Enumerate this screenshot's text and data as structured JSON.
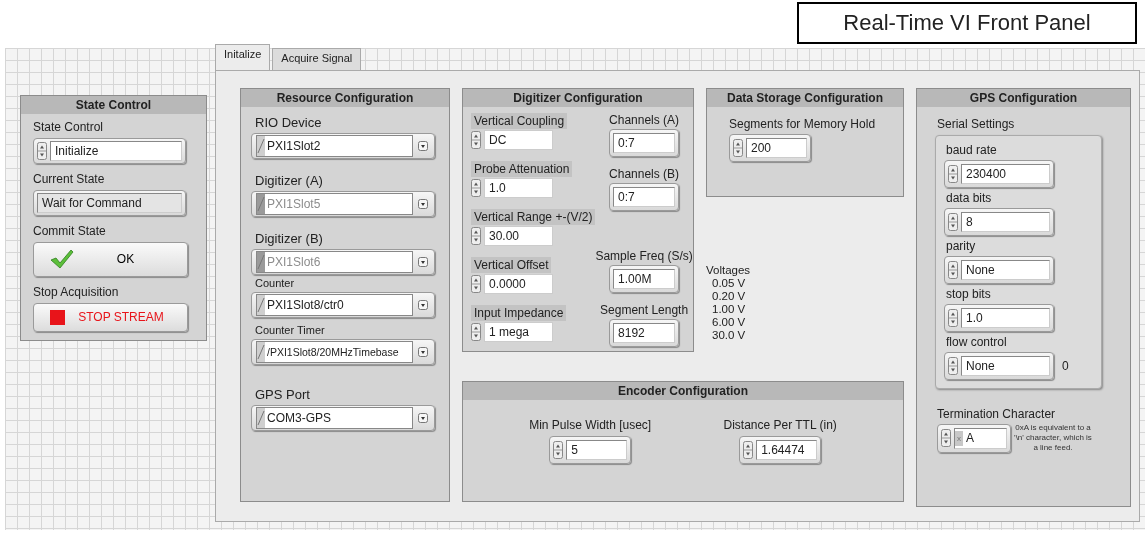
{
  "title": "Real-Time VI Front Panel",
  "state_control": {
    "title": "State Control",
    "controls": [
      {
        "kind": "ring",
        "label": "State Control",
        "value": "Initialize"
      },
      {
        "kind": "indicator",
        "label": "Current State",
        "value": "Wait for Command"
      },
      {
        "kind": "confirm_button",
        "label": "Commit State",
        "value": "OK"
      },
      {
        "kind": "stop_button",
        "label": "Stop Acquisition",
        "value": "STOP STREAM"
      }
    ]
  },
  "tabs": [
    {
      "label": "Initalize",
      "selected": true
    },
    {
      "label": "Acquire Signal",
      "selected": false
    }
  ],
  "resource_configuration": {
    "title": "Resource Configuration",
    "fields": [
      {
        "label": "RIO Device",
        "value": "PXI1Slot2",
        "disabled": false
      },
      {
        "label": "Digitizer (A)",
        "value": "PXI1Slot5",
        "disabled": true
      },
      {
        "label": "Digitizer (B)",
        "value": "PXI1Slot6",
        "disabled": true
      },
      {
        "label": "Counter",
        "value": "PXI1Slot8/ctr0",
        "disabled": false
      },
      {
        "label": "Counter Timer",
        "value": "/PXI1Slot8/20MHzTimebase",
        "disabled": false
      },
      {
        "label": "GPS Port",
        "value": "COM3-GPS",
        "disabled": false
      }
    ]
  },
  "digitizer_configuration": {
    "title": "Digitizer Configuration",
    "controls": [
      {
        "label": "Vertical Coupling",
        "value": "DC"
      },
      {
        "label": "Probe Attenuation",
        "value": "1.0"
      },
      {
        "label": "Vertical Range +-(V/2)",
        "value": "30.00"
      },
      {
        "label": "Vertical Offset",
        "value": "0.0000"
      },
      {
        "label": "Input Impedance",
        "value": "1 mega"
      }
    ],
    "indicators": [
      {
        "label": "Channels (A)",
        "value": "0:7"
      },
      {
        "label": "Channels (B)",
        "value": "0:7"
      },
      {
        "label": "Sample Freq (S/s)",
        "value": "1.00M"
      },
      {
        "label": "Segment Length",
        "value": "8192"
      }
    ]
  },
  "data_storage_configuration": {
    "title": "Data Storage Configuration",
    "fields": [
      {
        "label": "Segments for Memory Hold",
        "value": "200"
      }
    ]
  },
  "voltages": {
    "title": "Voltages",
    "values": [
      "0.05 V",
      "0.20 V",
      "1.00 V",
      "6.00 V",
      "30.0 V"
    ]
  },
  "encoder_configuration": {
    "title": "Encoder Configuration",
    "fields": [
      {
        "label": "Min Pulse Width [usec]",
        "value": "5"
      },
      {
        "label": "Distance Per TTL (in)",
        "value": "1.64474"
      }
    ]
  },
  "gps_configuration": {
    "title": "GPS Configuration",
    "serial_settings": {
      "label": "Serial Settings",
      "fields": [
        {
          "label": "baud rate",
          "value": "230400"
        },
        {
          "label": "data bits",
          "value": "8"
        },
        {
          "label": "parity",
          "value": "None"
        },
        {
          "label": "stop bits",
          "value": "1.0"
        },
        {
          "label": "flow control",
          "value": "None",
          "readout": "0"
        }
      ]
    },
    "termination_character": {
      "label": "Termination Character",
      "radix": "x",
      "value": "A",
      "note": "0xA is equivalent to a '\\n' character, which is a line feed."
    }
  }
}
